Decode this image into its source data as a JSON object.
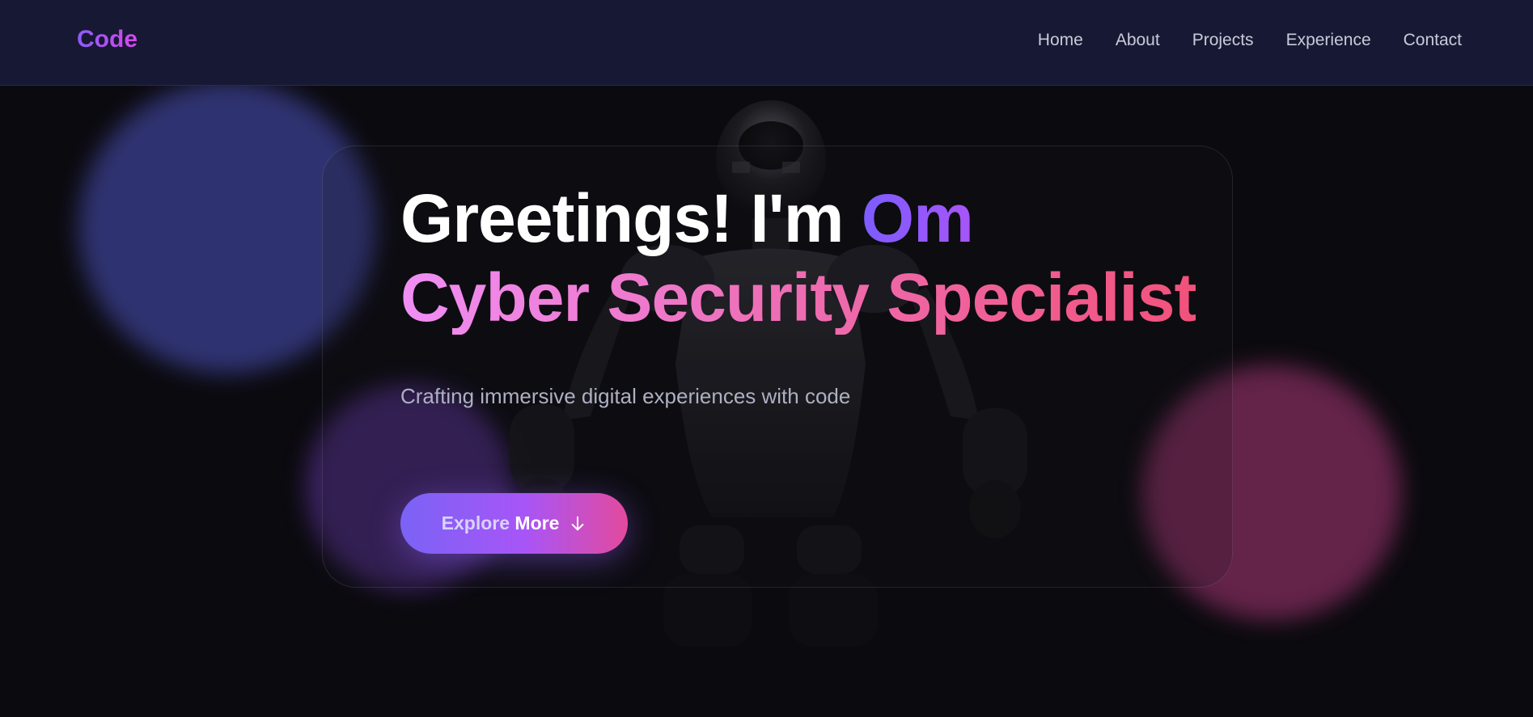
{
  "nav": {
    "logo": "Code",
    "links": [
      "Home",
      "About",
      "Projects",
      "Experience",
      "Contact"
    ]
  },
  "hero": {
    "greeting": "Greetings! I'm",
    "name": "Om",
    "role": "Cyber Security Specialist",
    "tagline": "Crafting immersive digital experiences with code",
    "button": {
      "lead": "Explore",
      "label": "More",
      "icon": "arrow-down-icon"
    }
  },
  "colors": {
    "nav_bg": "#171833",
    "page_bg": "#0b0a0f",
    "accent_purple": "#8b5cf6",
    "accent_pink": "#ec4899",
    "role_gradient": [
      "#f08ef5",
      "#ee6fb8",
      "#f1527a"
    ]
  }
}
